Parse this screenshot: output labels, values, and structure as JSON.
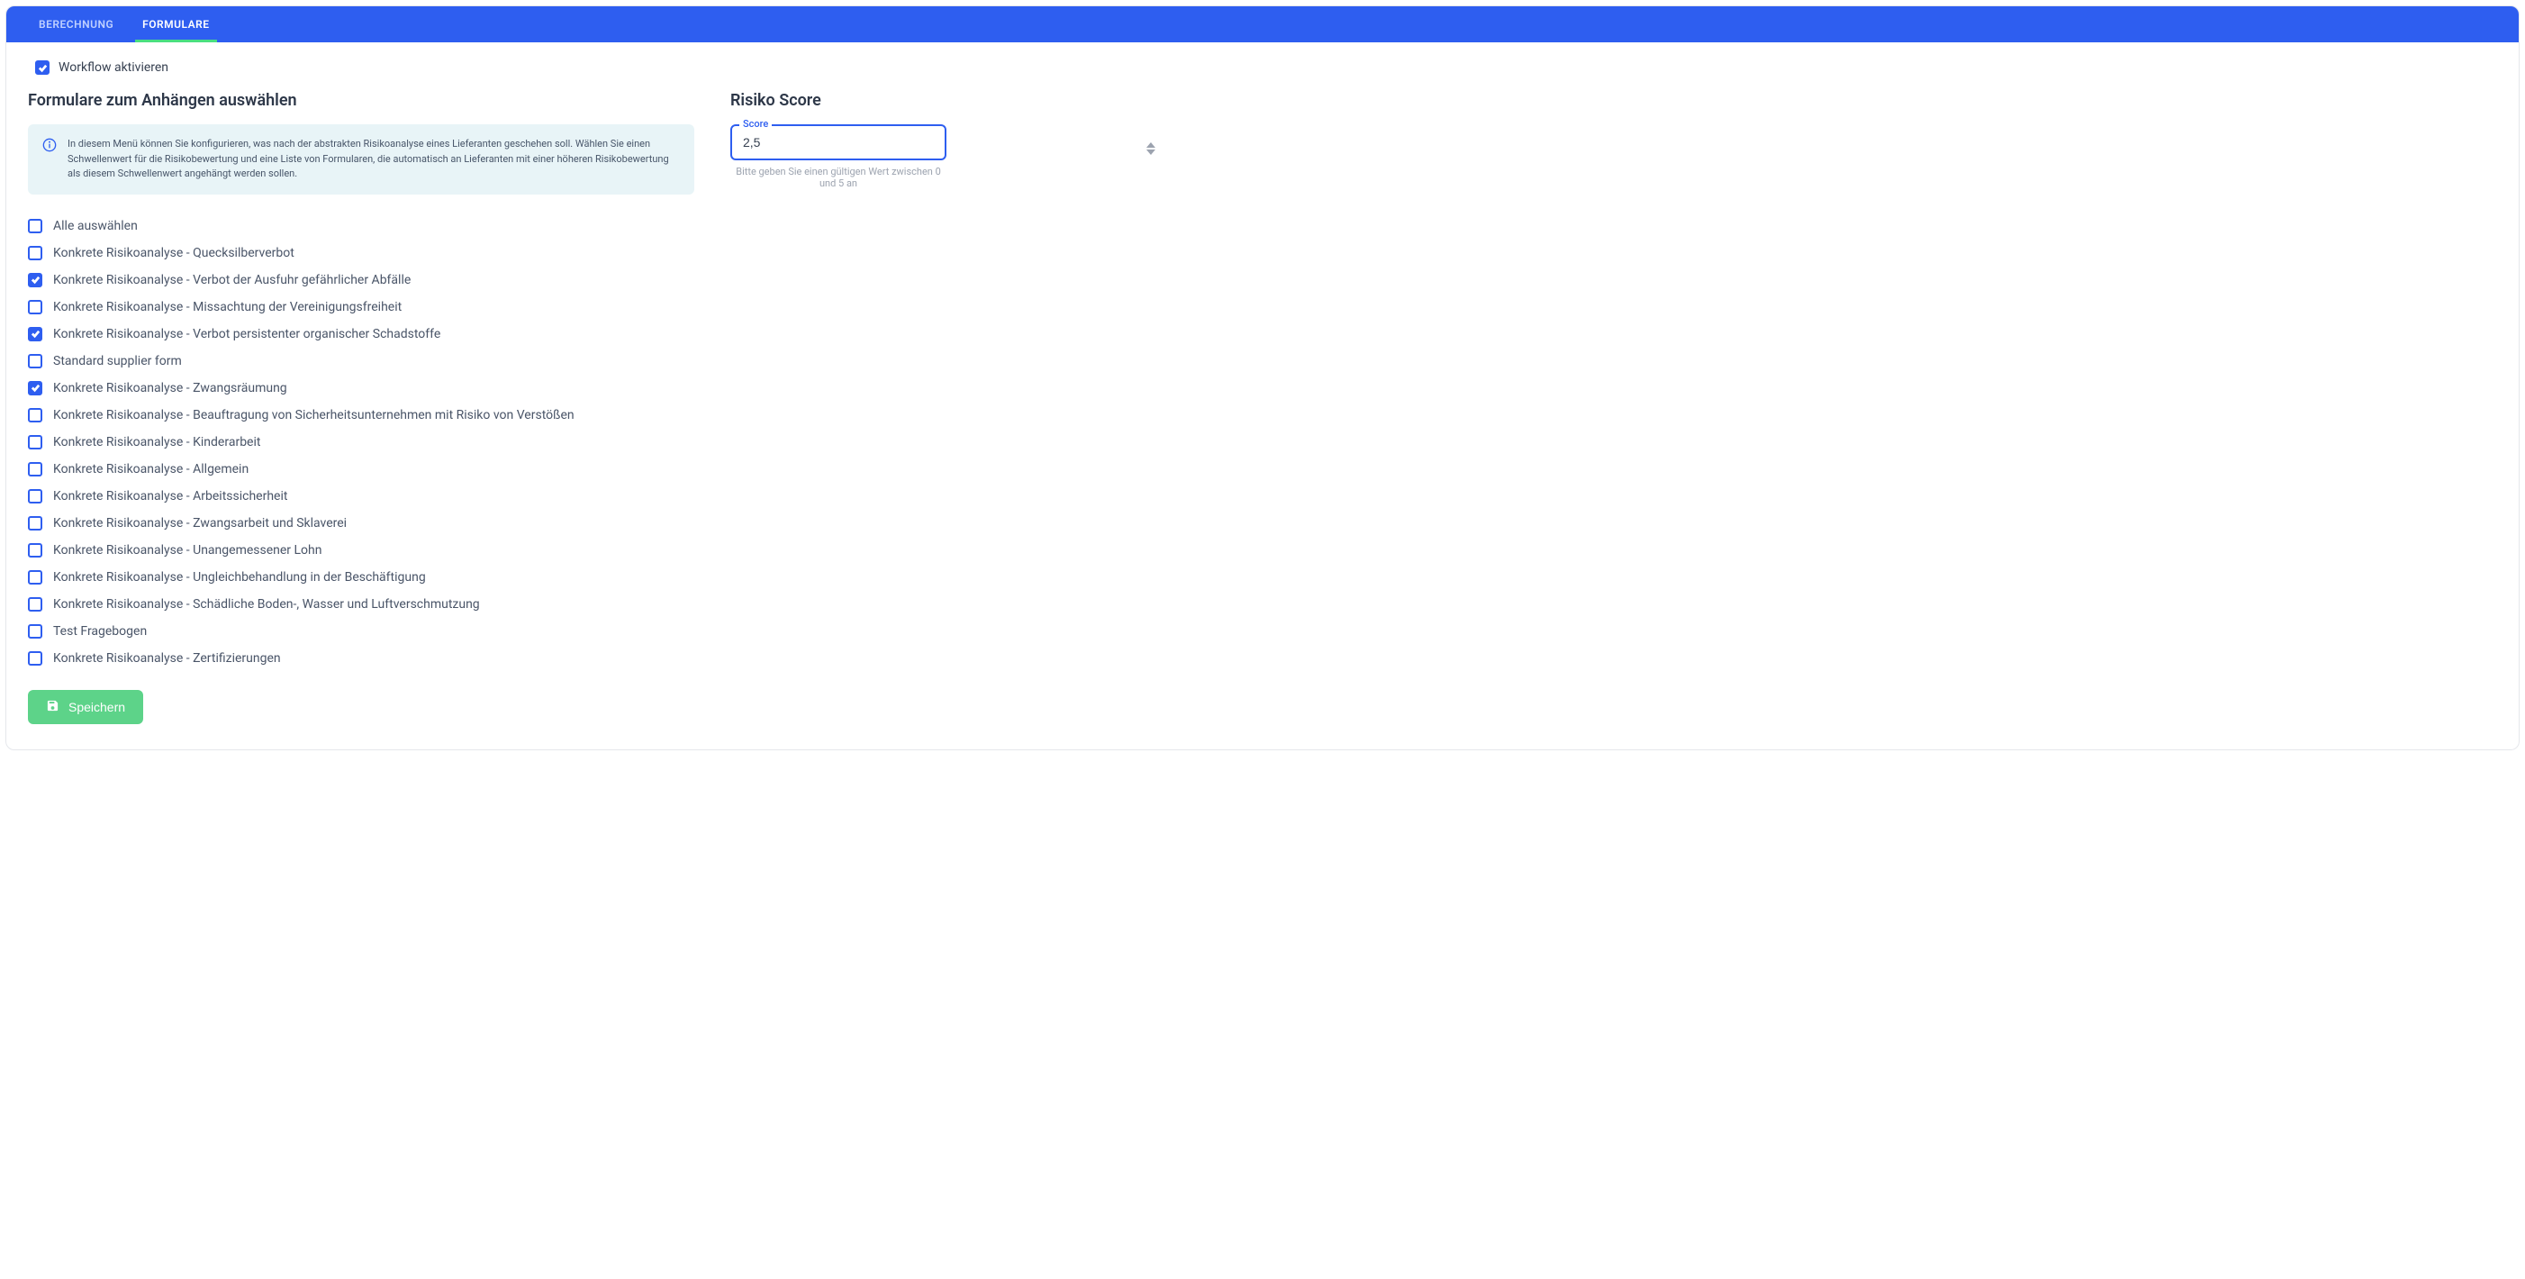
{
  "tabs": {
    "berechnung": "BERECHNUNG",
    "formulare": "FORMULARE"
  },
  "workflow": {
    "activate_label": "Workflow aktivieren",
    "checked": true
  },
  "forms_section": {
    "title": "Formulare zum Anhängen auswählen",
    "info_text": "In diesem Menü können Sie konfigurieren, was nach der abstrakten Risikoanalyse eines Lieferanten geschehen soll. Wählen Sie einen Schwellenwert für die Risikobewertung und eine Liste von Formularen, die automatisch an Lieferanten mit einer höheren Risikobewertung als diesem Schwellenwert angehängt werden sollen.",
    "items": [
      {
        "label": "Alle auswählen",
        "checked": false
      },
      {
        "label": "Konkrete Risikoanalyse - Quecksilberverbot",
        "checked": false
      },
      {
        "label": "Konkrete Risikoanalyse - Verbot der Ausfuhr gefährlicher Abfälle",
        "checked": true
      },
      {
        "label": "Konkrete Risikoanalyse - Missachtung der Vereinigungsfreiheit",
        "checked": false
      },
      {
        "label": "Konkrete Risikoanalyse - Verbot persistenter organischer Schadstoffe",
        "checked": true
      },
      {
        "label": "Standard supplier form",
        "checked": false
      },
      {
        "label": "Konkrete Risikoanalyse - Zwangsräumung",
        "checked": true
      },
      {
        "label": "Konkrete Risikoanalyse - Beauftragung von Sicherheitsunternehmen mit Risiko von Verstößen",
        "checked": false
      },
      {
        "label": "Konkrete Risikoanalyse - Kinderarbeit",
        "checked": false
      },
      {
        "label": "Konkrete Risikoanalyse - Allgemein",
        "checked": false
      },
      {
        "label": "Konkrete Risikoanalyse - Arbeitssicherheit",
        "checked": false
      },
      {
        "label": "Konkrete Risikoanalyse - Zwangsarbeit und Sklaverei",
        "checked": false
      },
      {
        "label": "Konkrete Risikoanalyse - Unangemessener Lohn",
        "checked": false
      },
      {
        "label": "Konkrete Risikoanalyse - Ungleichbehandlung in der Beschäftigung",
        "checked": false
      },
      {
        "label": "Konkrete Risikoanalyse - Schädliche Boden-, Wasser und Luftverschmutzung",
        "checked": false
      },
      {
        "label": "Test Fragebogen",
        "checked": false
      },
      {
        "label": "Konkrete Risikoanalyse - Zertifizierungen",
        "checked": false
      }
    ]
  },
  "score_section": {
    "title": "Risiko Score",
    "field_label": "Score",
    "value": "2,5",
    "hint": "Bitte geben Sie einen gültigen Wert zwischen 0 und 5 an"
  },
  "save_button": "Speichern"
}
